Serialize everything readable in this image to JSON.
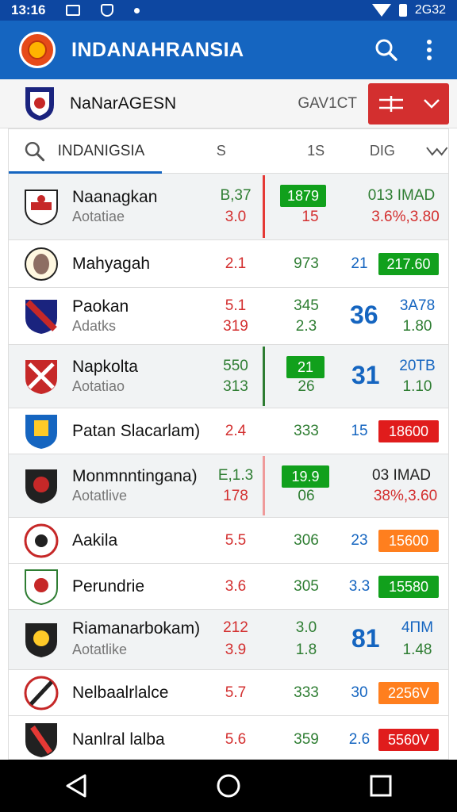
{
  "status_bar": {
    "time": "13:16",
    "signal": "2G32",
    "icons": [
      "image-icon",
      "shield-icon",
      "dot-icon",
      "wifi-icon",
      "battery-icon"
    ]
  },
  "app": {
    "title": "INDANAHRANSIA",
    "actions": [
      "search-icon",
      "more-vert-icon"
    ]
  },
  "league": {
    "name": "NaNarAGESN",
    "round": "GAV1CT",
    "filter_icons": [
      "filter-icon",
      "chevron-down-icon"
    ]
  },
  "table": {
    "group_label": "INDANIGSIA",
    "columns": [
      "S",
      "1S",
      "DIG"
    ],
    "rows": [
      {
        "name": "Naanagkan",
        "sub": "Aotatiae",
        "a": "B,37",
        "a2": "3.0",
        "b": "1879",
        "b2": "15",
        "c": "013 IMAD",
        "c2": "3.6%,3.80"
      },
      {
        "name": "Mahyagah",
        "a": "2.1",
        "b": "973",
        "c": "21",
        "d": "217.60"
      },
      {
        "name": "Paokan",
        "sub": "Adatks",
        "a": "5.1",
        "a2": "319",
        "b": "345",
        "b2": "2.3",
        "c": "36",
        "d": "3A78",
        "d2": "1.80"
      },
      {
        "name": "Napkolta",
        "sub": "Aotatiao",
        "a": "550",
        "a2": "313",
        "b": "21",
        "b2": "26",
        "c": "31",
        "d": "20TB",
        "d2": "1.10"
      },
      {
        "name": "Patan Slacarlam)",
        "a": "2.4",
        "b": "333",
        "c": "15",
        "d": "18600"
      },
      {
        "name": "Monmnntingana)",
        "sub": "Aotatlive",
        "a": "E,1.3",
        "a2": "178",
        "b": "19.9",
        "b2": "06",
        "c": "03 IMAD",
        "c2": "38%,3.60"
      },
      {
        "name": "Aakila",
        "a": "5.5",
        "b": "306",
        "c": "23",
        "d": "15600"
      },
      {
        "name": "Perundrie",
        "a": "3.6",
        "b": "305",
        "c": "3.3",
        "d": "15580"
      },
      {
        "name": "Riamanarbokam)",
        "sub": "Aotatlike",
        "a": "212",
        "a2": "3.9",
        "b": "3.0",
        "b2": "1.8",
        "c": "81",
        "d": "4ПМ",
        "d2": "1.48"
      },
      {
        "name": "Nelbaalrlalce",
        "a": "5.7",
        "b": "333",
        "c": "30",
        "d": "2256V"
      },
      {
        "name": "Nanlral lalba",
        "a": "5.6",
        "b": "359",
        "c": "2.6",
        "d": "5560V"
      }
    ]
  },
  "colors": {
    "primary": "#1565c0",
    "status": "#0d47a1",
    "accent_red": "#d32f2f",
    "green": "#11a01c",
    "orange": "#ff7f1e"
  },
  "nav": [
    "back-icon",
    "home-icon",
    "recents-icon"
  ]
}
